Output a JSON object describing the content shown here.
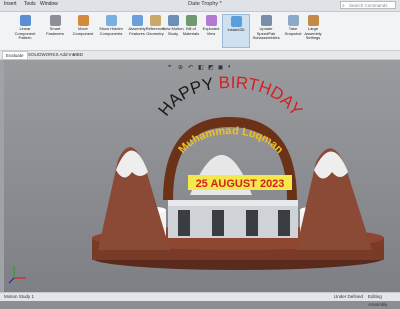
{
  "window": {
    "menus": [
      "Insert",
      "Tools",
      "Window"
    ],
    "title": "Date Trophy *",
    "search_placeholder": "Search Commands"
  },
  "ribbon": {
    "buttons": [
      {
        "label": "Linear Component Pattern",
        "icon": "pattern-icon",
        "color": "#5a8fd1"
      },
      {
        "label": "Smart Fasteners",
        "icon": "fastener-icon",
        "color": "#8a8f98"
      },
      {
        "label": "Move Component",
        "icon": "move-icon",
        "color": "#d48a3a"
      },
      {
        "label": "Show Hidden Components",
        "icon": "show-hidden-icon",
        "color": "#7ab0e0"
      },
      {
        "label": "Assembly Features",
        "icon": "assembly-features-icon",
        "color": "#6a9fd8"
      },
      {
        "label": "Reference Geometry",
        "icon": "reference-geometry-icon",
        "color": "#c9a86a"
      },
      {
        "label": "New Motion Study",
        "icon": "motion-study-icon",
        "color": "#6b8fb8"
      },
      {
        "label": "Bill of Materials",
        "icon": "bom-icon",
        "color": "#6f9a6f"
      },
      {
        "label": "Exploded View",
        "icon": "exploded-view-icon",
        "color": "#b07bd0"
      },
      {
        "label": "Instant3D",
        "icon": "instant3d-icon",
        "color": "#5a9fd9"
      },
      {
        "label": "Update SpeedPak Subassemblies",
        "icon": "speedpak-icon",
        "color": "#7a8ea8"
      },
      {
        "label": "Take Snapshot",
        "icon": "snapshot-icon",
        "color": "#8aa8c8"
      },
      {
        "label": "Large Assembly Settings",
        "icon": "large-assembly-icon",
        "color": "#c48a4a"
      }
    ],
    "active_index": 9
  },
  "tabs": [
    "Evaluate",
    "SOLIDWORKS Add-Ins",
    "MBD"
  ],
  "model": {
    "line1": "HAPPY BIRTHDAY",
    "line2": "Muhammad Luqman",
    "date": "25 AUGUST 2023",
    "colors": {
      "happy": "#1a1a1a",
      "birthday": "#d42020",
      "name_text": "#f0c020",
      "arch": "#6b3218",
      "date_text": "#d42020",
      "date_bg": "#f5e84a",
      "base": "#7a3a28",
      "mountain": "#8a4a36",
      "snow": "#eeeeee"
    }
  },
  "status": {
    "tab": "Motion Study 1",
    "units": "Under Defined",
    "mode": "Editing Assembly"
  }
}
